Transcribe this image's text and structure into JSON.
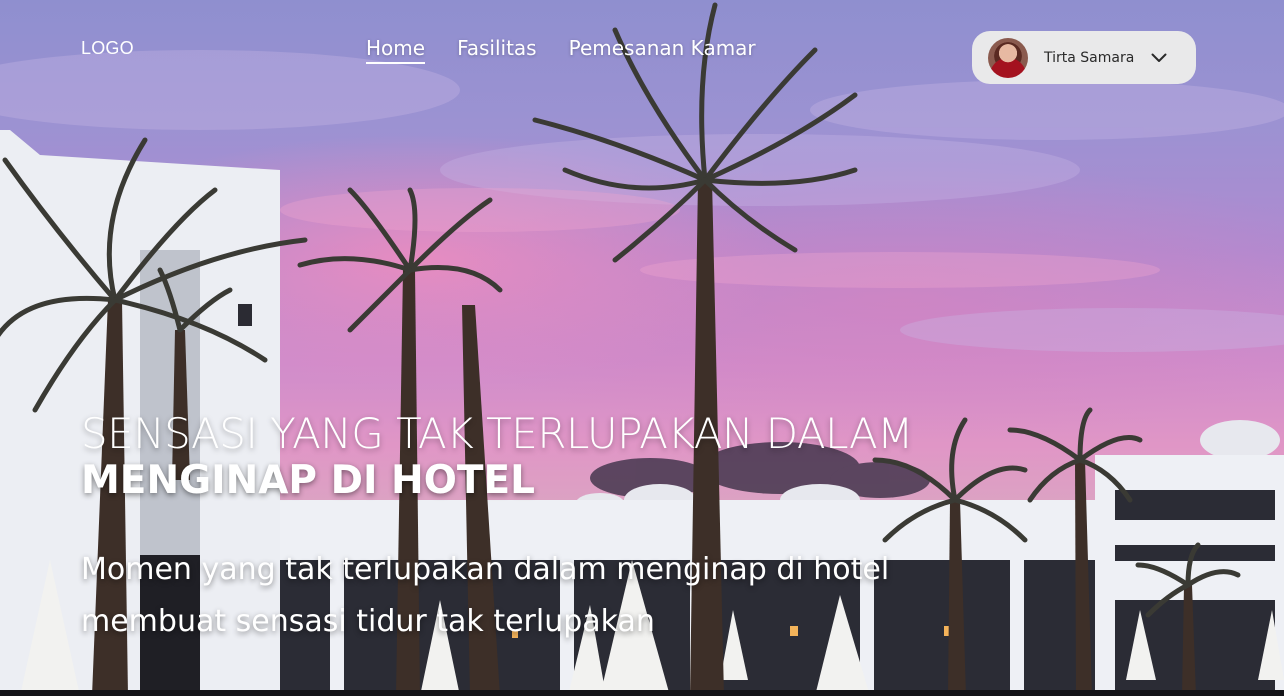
{
  "header": {
    "logo": "LOGO",
    "nav": [
      {
        "label": "Home",
        "active": true
      },
      {
        "label": "Fasilitas",
        "active": false
      },
      {
        "label": "Pemesanan Kamar",
        "active": false
      }
    ],
    "user": {
      "name": "Tirta Samara",
      "avatar_icon": "avatar-photo",
      "dropdown_icon": "chevron-down-icon"
    }
  },
  "hero": {
    "headline_line1": "SENSASI YANG TAK TERLUPAKAN DALAM",
    "headline_line2": "MENGINAP DI HOTEL",
    "subtitle": "Momen yang tak terlupakan dalam menginap di hotel membuat sensasi tidur tak terlupakan",
    "background": "hotel-palm-trees-sunset"
  },
  "colors": {
    "text": "#ffffff",
    "user_pill": "#e9e9ea",
    "sky_top": "#8f8fcf",
    "sky_pink": "#e096c6"
  }
}
